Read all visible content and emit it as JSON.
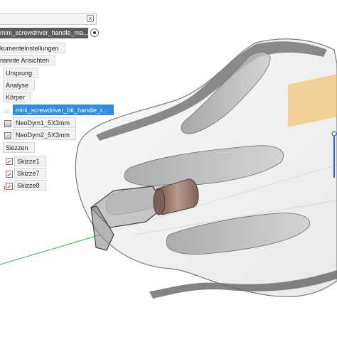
{
  "browser": {
    "document_name": "mini_screwdriver_handle_ma...",
    "tree": {
      "doc_settings": "kumenteinstellungen",
      "named_views": "nannte Ansichten",
      "origin": "Ursprung",
      "analysis": "Analyse",
      "bodies": "Körper",
      "body_items": [
        "mini_screwdriver_bit_handle_r...",
        "NeoDym1_5X3mm",
        "NeoDym2_5X3mm"
      ],
      "sketches": "Skizzen",
      "sketch_items": [
        "Skizze1",
        "Skizze7",
        "Skizze8"
      ]
    },
    "close_glyph": "×"
  },
  "colors": {
    "selection": "#2f8de4",
    "doc_header": "#5b5b5b",
    "x_axis": "#e03a3a",
    "y_axis": "#2fbf3f",
    "z_axis": "#3b5bd9"
  }
}
